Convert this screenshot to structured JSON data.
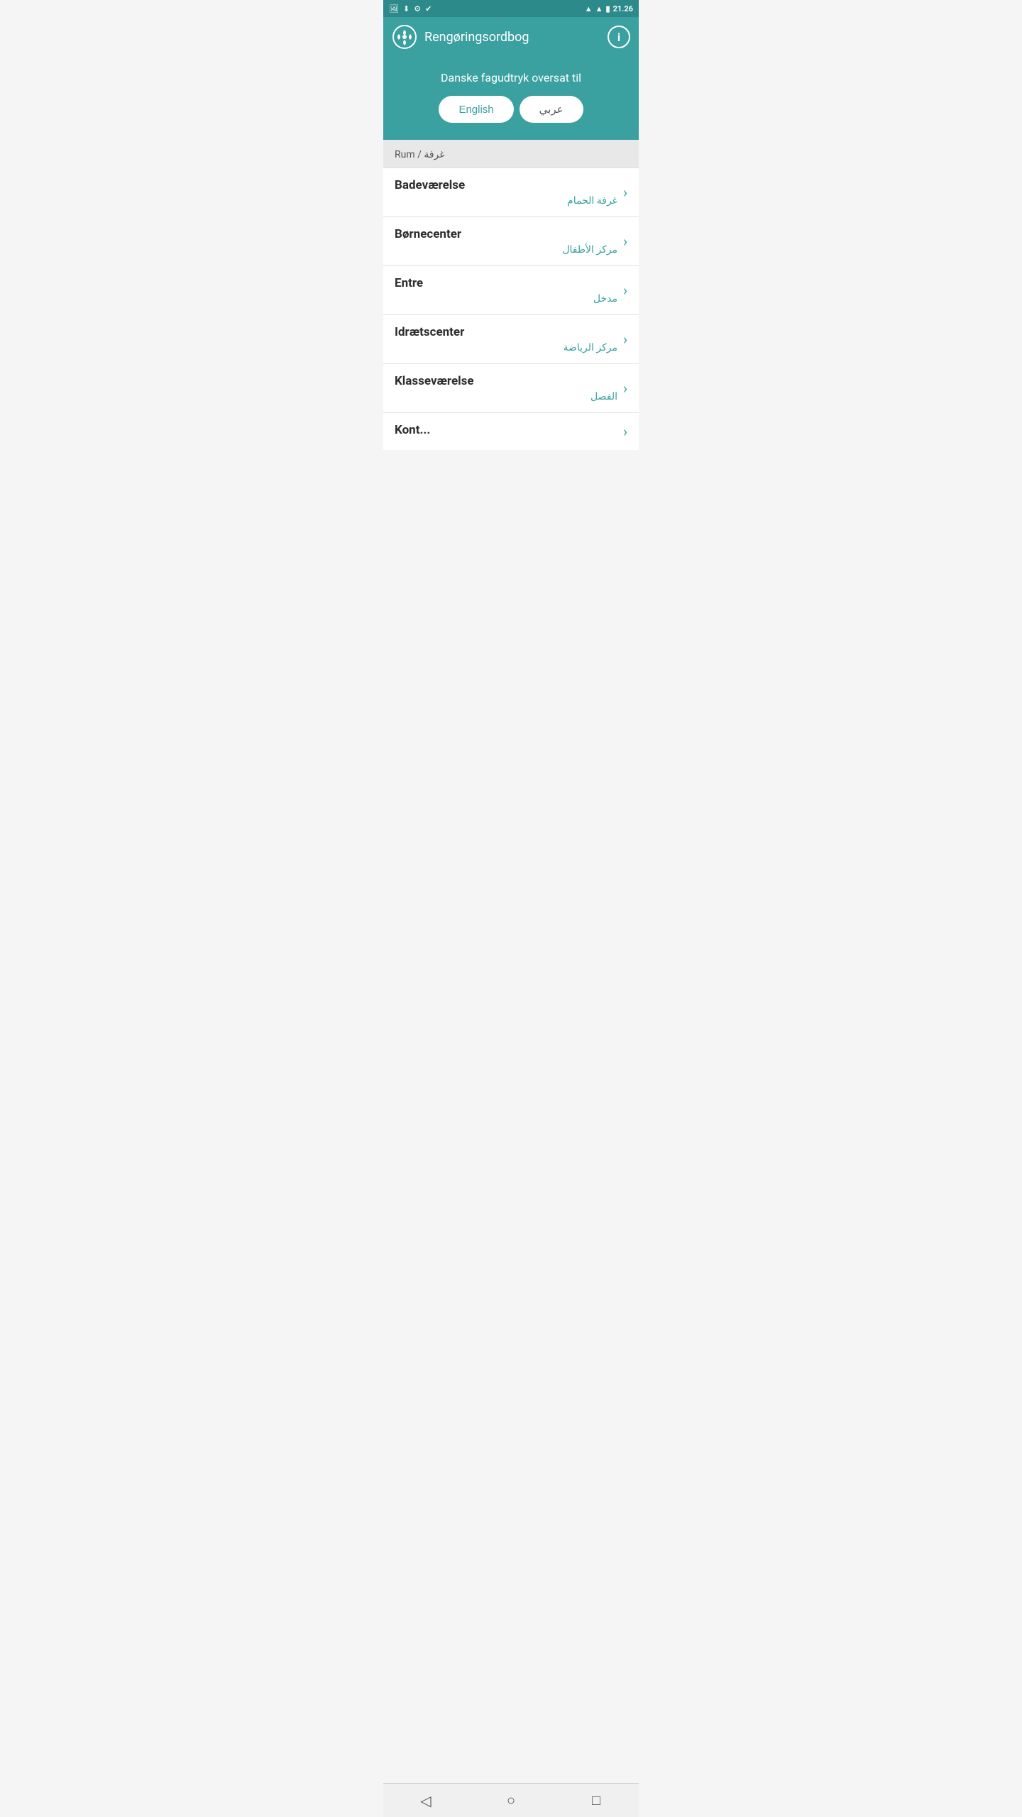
{
  "statusBar": {
    "time": "21.26",
    "icons": [
      "photo",
      "download",
      "settings",
      "check"
    ]
  },
  "appBar": {
    "title": "Rengøringsordbog",
    "infoLabel": "i"
  },
  "header": {
    "subtitle": "Danske fagudtryk oversat til",
    "btnEnglish": "English",
    "btnArabic": "عربي"
  },
  "categoryHeader": {
    "text": "Rum / غرفة"
  },
  "listItems": [
    {
      "danish": "Badeværelse",
      "arabic": "غرفة الحمام"
    },
    {
      "danish": "Børnecenter",
      "arabic": "مركز الأطفال"
    },
    {
      "danish": "Entre",
      "arabic": "مدخل"
    },
    {
      "danish": "Idrætscenter",
      "arabic": "مركز الرياضة"
    },
    {
      "danish": "Klasseværelse",
      "arabic": "الفصل"
    },
    {
      "danish": "Kont...",
      "arabic": ""
    }
  ],
  "bottomNav": {
    "backIcon": "◁",
    "homeIcon": "○",
    "squareIcon": "□"
  }
}
